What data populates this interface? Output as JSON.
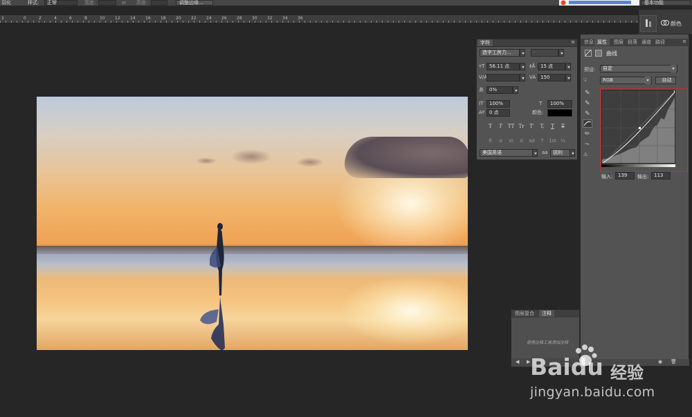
{
  "options_bar": {
    "cut_label": "羽化",
    "style_label": "样式:",
    "style_value": "正常",
    "width_label": "宽度:",
    "height_label": "高度:",
    "refine_button": "调整边缘..."
  },
  "workspace": {
    "label": "基本功能"
  },
  "ruler": {
    "ticks": [
      "2",
      "0",
      "2",
      "4",
      "6",
      "8",
      "10",
      "12",
      "14",
      "16",
      "18",
      "20",
      "22",
      "24",
      "26",
      "28",
      "30",
      "32",
      "34",
      "36"
    ]
  },
  "dock": {
    "color_label": "颜色"
  },
  "character_panel": {
    "tab": "字符",
    "font_family": "造字工房力...",
    "font_style": "-",
    "font_size": "56.11 点",
    "leading": "15 点",
    "kerning": "",
    "tracking": "150",
    "scale_pct": "0%",
    "vscale": "100%",
    "hscale": "100%",
    "baseline": "0 点",
    "color_label": "颜色:",
    "language": "美国英语",
    "aa_prefix": "aa",
    "antialias": "锐利",
    "style_buttons": [
      "T",
      "T",
      "TT",
      "Tr",
      "T'",
      "T,",
      "T",
      "T"
    ],
    "ot_buttons": [
      "fi",
      "ơ",
      "st",
      "A",
      "ad",
      "T",
      "1st",
      "½"
    ]
  },
  "properties_panel": {
    "tabs": [
      "信息",
      "属性",
      "图层",
      "段落",
      "通道",
      "路径"
    ],
    "active_tab": "属性",
    "adjustment_title": "曲线",
    "preset_label": "预设:",
    "preset_value": "自定",
    "channel_value": "RGB",
    "auto_button": "自动",
    "input_label": "输入:",
    "input_value": "139",
    "output_label": "输出:",
    "output_value": "113"
  },
  "notes_panel": {
    "tabs": [
      "图层复合",
      "注释"
    ],
    "active_tab": "注释",
    "hint": "使用注释工具添加注释"
  },
  "watermark": {
    "brand": "Baidu",
    "cn": "经验",
    "url": "jingyan.baidu.com"
  }
}
